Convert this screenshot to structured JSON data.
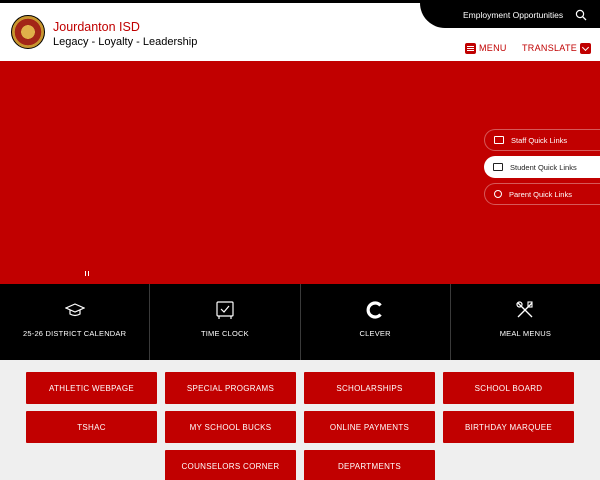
{
  "header": {
    "school_name": "Jourdanton ISD",
    "motto": "Legacy - Loyalty - Leadership",
    "employment_link": "Employment Opportunities",
    "menu_label": "MENU",
    "translate_label": "TRANSLATE"
  },
  "quick_links": [
    {
      "label": "Staff Quick Links",
      "icon": "id-card-icon"
    },
    {
      "label": "Student Quick Links",
      "icon": "students-icon"
    },
    {
      "label": "Parent Quick Links",
      "icon": "parent-icon"
    }
  ],
  "tiles": [
    {
      "label": "25-26 DISTRICT CALENDAR",
      "icon": "graduation-cap-icon"
    },
    {
      "label": "TIME CLOCK",
      "icon": "clock-icon"
    },
    {
      "label": "CLEVER",
      "icon": "clever-logo-icon"
    },
    {
      "label": "MEAL MENUS",
      "icon": "utensils-icon"
    }
  ],
  "buttons": [
    "ATHLETIC WEBPAGE",
    "SPECIAL PROGRAMS",
    "SCHOLARSHIPS",
    "SCHOOL BOARD",
    "TSHAC",
    "MY SCHOOL BUCKS",
    "ONLINE PAYMENTS",
    "BIRTHDAY MARQUEE",
    "COUNSELORS CORNER",
    "DEPARTMENTS"
  ],
  "colors": {
    "brand_red": "#c10000",
    "dark": "#000000"
  }
}
